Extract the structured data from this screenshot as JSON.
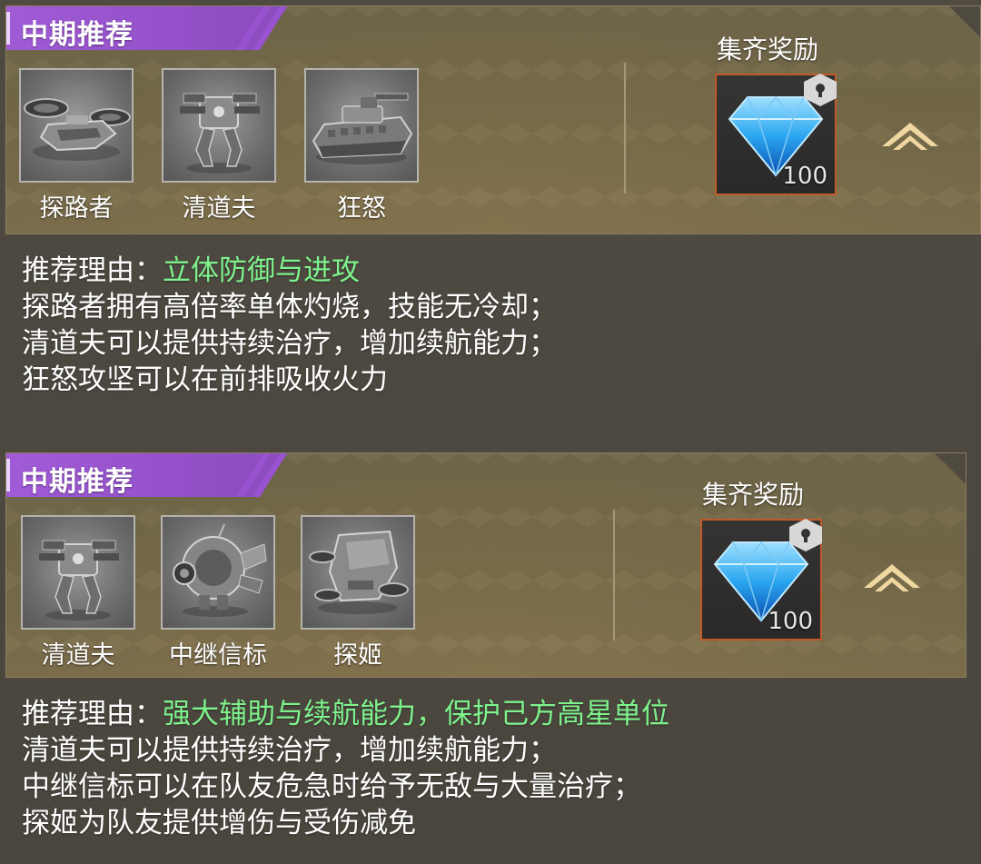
{
  "sections": [
    {
      "banner_title": "中期推荐",
      "units": [
        {
          "name": "探路者",
          "icon": "hover-drone-icon"
        },
        {
          "name": "清道夫",
          "icon": "mech-walker-icon"
        },
        {
          "name": "狂怒",
          "icon": "tank-icon"
        }
      ],
      "reward": {
        "title": "集齐奖励",
        "item_icon": "blue-diamond-icon",
        "quantity": "100"
      },
      "reason_label": "推荐理由：",
      "reason_title": "立体防御与进攻",
      "reason_lines": [
        "探路者拥有高倍率单体灼烧，技能无冷却；",
        "清道夫可以提供持续治疗，增加续航能力；",
        "狂怒攻坚可以在前排吸收火力"
      ]
    },
    {
      "banner_title": "中期推荐",
      "units": [
        {
          "name": "清道夫",
          "icon": "mech-walker-icon"
        },
        {
          "name": "中继信标",
          "icon": "beacon-pod-icon"
        },
        {
          "name": "探姬",
          "icon": "scout-hover-icon"
        }
      ],
      "reward": {
        "title": "集齐奖励",
        "item_icon": "blue-diamond-icon",
        "quantity": "100"
      },
      "reason_label": "推荐理由：",
      "reason_title": "强大辅助与续航能力，保护己方高星单位",
      "reason_lines": [
        "清道夫可以提供持续治疗，增加续航能力；",
        "中继信标可以在队友危急时给予无敌与大量治疗；",
        "探姬为队友提供增伤与受伤减免"
      ]
    }
  ],
  "colors": {
    "banner": "#9b56d2",
    "reason_highlight": "#7ef28c",
    "reward_border": "#c15a2a",
    "diamond": "#2aa6f0",
    "chevron": "#f0d6a0"
  }
}
